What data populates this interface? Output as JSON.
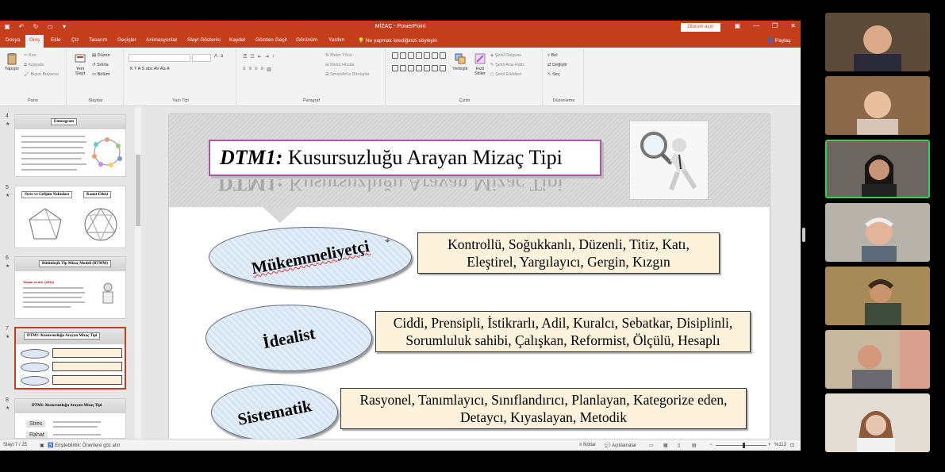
{
  "window": {
    "title": "MİZAÇ  -  PowerPoint",
    "sign_in": "Oturum açın",
    "share": "Paylaş"
  },
  "tabs": [
    "Dosya",
    "Giriş",
    "Ekle",
    "Çiz",
    "Tasarım",
    "Geçişler",
    "Animasyonlar",
    "Slayt Gösterisi",
    "Kaydet",
    "Gözden Geçir",
    "Görünüm",
    "Yardım"
  ],
  "active_tab": "Giriş",
  "tell_me": "Ne yapmak istediğinizi söyleyin",
  "ribbon": {
    "clipboard": {
      "paste": "Yapıştır",
      "cut": "Kes",
      "copy": "Kopyala",
      "format_painter": "Biçim Boyacısı",
      "label": "Pano"
    },
    "slides": {
      "new_slide_1": "Yeni",
      "new_slide_2": "Slayt",
      "layout": "Düzen",
      "reset": "Sıfırla",
      "section": "Bölüm",
      "label": "Slaytlar"
    },
    "font": {
      "label": "Yazı Tipi",
      "buttons": "K  T  A  S  abc  AV  Aa  A"
    },
    "paragraph": {
      "text_direction": "Metin Yönü",
      "align_text": "Metni Hizala",
      "smartart": "SmartArt'a Dönüştür",
      "label": "Paragraf"
    },
    "drawing": {
      "arrange_1": "Yerleştir",
      "quick_styles_1": "Hızlı",
      "quick_styles_2": "Stiller",
      "shape_fill": "Şekil Dolgusu",
      "shape_outline": "Şekil Ana Hattı",
      "shape_effects": "Şekil Efektleri",
      "label": "Çizim"
    },
    "editing": {
      "find": "Bul",
      "replace": "Değiştir",
      "select": "Seç",
      "label": "Düzenleme"
    }
  },
  "thumbnails": [
    {
      "num": "4",
      "title": "Enneagram"
    },
    {
      "num": "5",
      "title_a": "Stres ve Gelişim Noktaları",
      "title_b": "Kanat Etkisi"
    },
    {
      "num": "6",
      "title": "Bütünleşik Tip Mizaç Modeli (BTMM)",
      "subtitle": "Tekam ve ark. (2014)"
    },
    {
      "num": "7",
      "title": "DTM1: Kusursuzluğu Arayan Mizaç Tipi",
      "active": true
    },
    {
      "num": "8",
      "title": "DTM1: Kusursuzluğu Arayan Mizaç Tipi",
      "stres": "Stres",
      "rahat": "Rahat"
    }
  ],
  "slide": {
    "title_bold": "DTM1:",
    "title_rest": " Kusursuzluğu Arayan Mizaç Tipi",
    "ellipses": [
      {
        "label": "Mükemmeliyetçi"
      },
      {
        "label": "İdealist"
      },
      {
        "label": "Sistematik"
      }
    ],
    "boxes": [
      {
        "line1": "Kontrollü, Soğukkanlı, Düzenli, Titiz, Katı,",
        "line2": "Eleştirel, Yargılayıcı, Gergin, Kızgın"
      },
      {
        "line1": "Ciddi, Prensipli, İstikrarlı, Adil, Kuralcı, Sebatkar, Disiplinli,",
        "line2": "Sorumluluk sahibi, Çalışkan, Reformist, Ölçülü, Hesaplı"
      },
      {
        "line1": "Rasyonel, Tanımlayıcı, Sınıflandırıcı, Planlayan, Kategorize eden,",
        "line2": "Detaycı, Kıyaslayan, Metodik"
      }
    ]
  },
  "status": {
    "slide_count": "Slayt 7 / 25",
    "accessibility": "Erişilebilirlik: Önerilere göz atın",
    "notes": "Notlar",
    "comments": "Açıklamalar",
    "zoom": "%113"
  },
  "participants": [
    {
      "bg": "#5c4a3a",
      "skin": "#d9a98a"
    },
    {
      "bg": "#8a6a4a",
      "skin": "#e8c0a0"
    },
    {
      "bg": "#6b6760",
      "skin": "#c89478"
    },
    {
      "bg": "#b7b2aa",
      "skin": "#e3b49a"
    },
    {
      "bg": "#a68a5a",
      "skin": "#c9956d"
    },
    {
      "bg": "#c8b8a0",
      "skin": "#d29a7a"
    },
    {
      "bg": "#e2dcd3",
      "skin": "#e8c5b0"
    }
  ]
}
